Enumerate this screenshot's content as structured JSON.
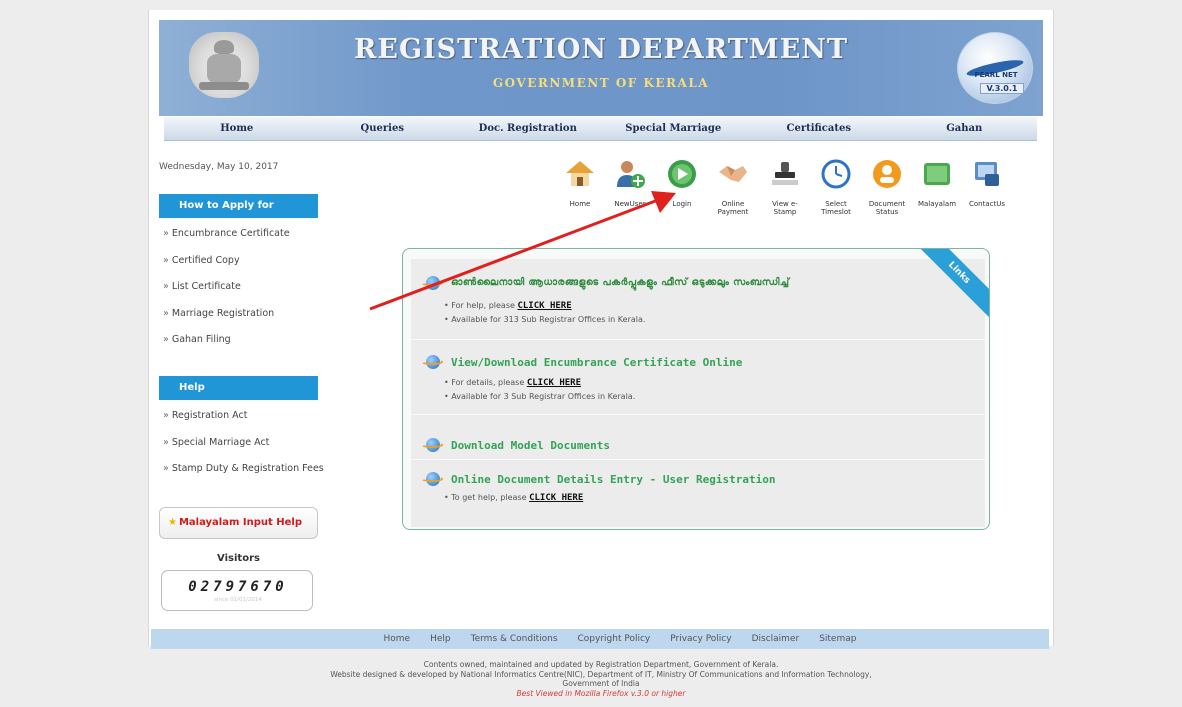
{
  "header": {
    "title": "REGISTRATION DEPARTMENT",
    "subtitle": "GOVERNMENT OF KERALA",
    "logo_text": "PEARL NET",
    "logo_version": "V.3.0.1"
  },
  "nav": [
    "Home",
    "Queries",
    "Doc. Registration",
    "Special Marriage",
    "Certificates",
    "Gahan"
  ],
  "date": "Wednesday, May 10, 2017",
  "sidebar": {
    "apply_heading": "How to Apply for",
    "apply_items": [
      "Encumbrance Certificate",
      "Certified Copy",
      "List Certificate",
      "Marriage Registration",
      "Gahan Filing"
    ],
    "help_heading": "Help",
    "help_items": [
      "Registration Act",
      "Special Marriage Act",
      "Stamp Duty & Registration Fees"
    ],
    "malayalam_help": "Malayalam Input Help",
    "visitors_label": "Visitors",
    "visitors_count": "02797670",
    "visitors_sub": "since 01/01/2014"
  },
  "quick_icons": [
    {
      "label": "Home",
      "icon": "home-icon"
    },
    {
      "label": "NewUser",
      "icon": "new-user-icon"
    },
    {
      "label": "Login",
      "icon": "login-icon"
    },
    {
      "label": "Online Payment",
      "icon": "handshake-icon"
    },
    {
      "label": "View e-Stamp",
      "icon": "stamp-icon"
    },
    {
      "label": "Select Timeslot",
      "icon": "clock-icon"
    },
    {
      "label": "Document Status",
      "icon": "document-status-icon"
    },
    {
      "label": "Malayalam",
      "icon": "malayalam-icon"
    },
    {
      "label": "ContactUs",
      "icon": "contact-icon"
    }
  ],
  "panel": {
    "ribbon": "Links",
    "items": [
      {
        "title": "ഓൺലൈനായി ആധാരങ്ങളുടെ പകർപ്പുകളും ഫീസ് ഒടുക്കലും സംബന്ധിച്ച്",
        "line1_prefix": "For help, please",
        "line1_link": "CLICK HERE",
        "line2": "Available for 313 Sub Registrar Offices in Kerala."
      },
      {
        "title": "View/Download Encumbrance Certificate Online",
        "line1_prefix": "For details, please",
        "line1_link": "CLICK HERE",
        "line2": "Available for 3 Sub Registrar Offices in Kerala."
      },
      {
        "title": "Download Model Documents"
      },
      {
        "title": "Online Document Details Entry - User Registration",
        "line1_prefix": "To get help, please",
        "line1_link": "CLICK HERE"
      }
    ]
  },
  "footer_nav": [
    "Home",
    "Help",
    "Terms & Conditions",
    "Copyright Policy",
    "Privacy Policy",
    "Disclaimer",
    "Sitemap"
  ],
  "footer": {
    "line1": "Contents owned, maintained and updated by Registration Department, Government of Kerala.",
    "line2": "Website designed & developed by National Informatics Centre(NIC), Department of IT, Ministry Of Communications and Information Technology,",
    "line3": "Government of India",
    "browser_note": "Best Viewed in Mozilla Firefox v.3.0 or higher"
  },
  "colors": {
    "header_blue": "#6d95c8",
    "sidebar_head": "#2196d6",
    "title_green": "#34a356",
    "annotation_red": "#e0201c"
  }
}
